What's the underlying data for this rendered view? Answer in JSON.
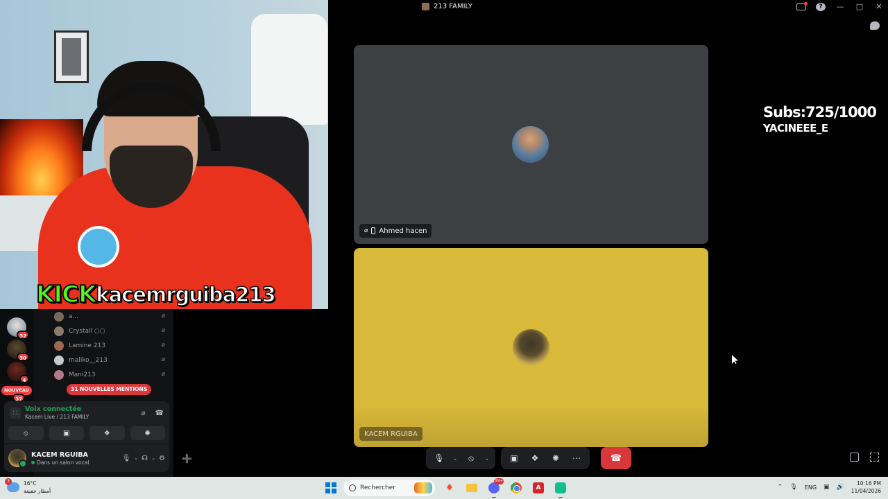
{
  "window": {
    "title": "213 FAMILY"
  },
  "stream_overlay": {
    "platform_logo": "KICK",
    "channel": "kacemrguiba213",
    "subs_line": "Subs:725/1000",
    "subs_user": "YACINEEE_E"
  },
  "tiles": [
    {
      "name": "Ahmed hacen",
      "bg": "#3d4043"
    },
    {
      "name": "KACEM RGUIBA",
      "bg": "#d9b93a"
    }
  ],
  "guilds": [
    {
      "badge": "32"
    },
    {
      "badge": "30"
    },
    {
      "badge": "4"
    },
    {
      "badge": "37"
    }
  ],
  "new_pill": "NOUVEAU",
  "members": [
    {
      "name": "a..."
    },
    {
      "name": "Crystall ○○"
    },
    {
      "name": "Lamine 213"
    },
    {
      "name": "maliko__213"
    },
    {
      "name": "Mani213"
    }
  ],
  "mentions_pill": "31 NOUVELLES MENTIONS",
  "voice_panel": {
    "status": "Voix connectée",
    "channel": "Kacem Live / 213 FAMILY"
  },
  "user_panel": {
    "name": "KACEM RGUIBA",
    "status": "Dans un salon vocal"
  },
  "taskbar": {
    "weather_temp": "16°C",
    "weather_desc": "أمطار خفيفة",
    "weather_badge": "3",
    "search_placeholder": "Rechercher",
    "discord_badge": "99+",
    "language": "ENG",
    "time": "10:16 PM",
    "date": "11/04/2026"
  },
  "colors": {
    "accent_green": "#23a55a",
    "hangup_red": "#da373c",
    "kick_green": "#53fc18"
  }
}
